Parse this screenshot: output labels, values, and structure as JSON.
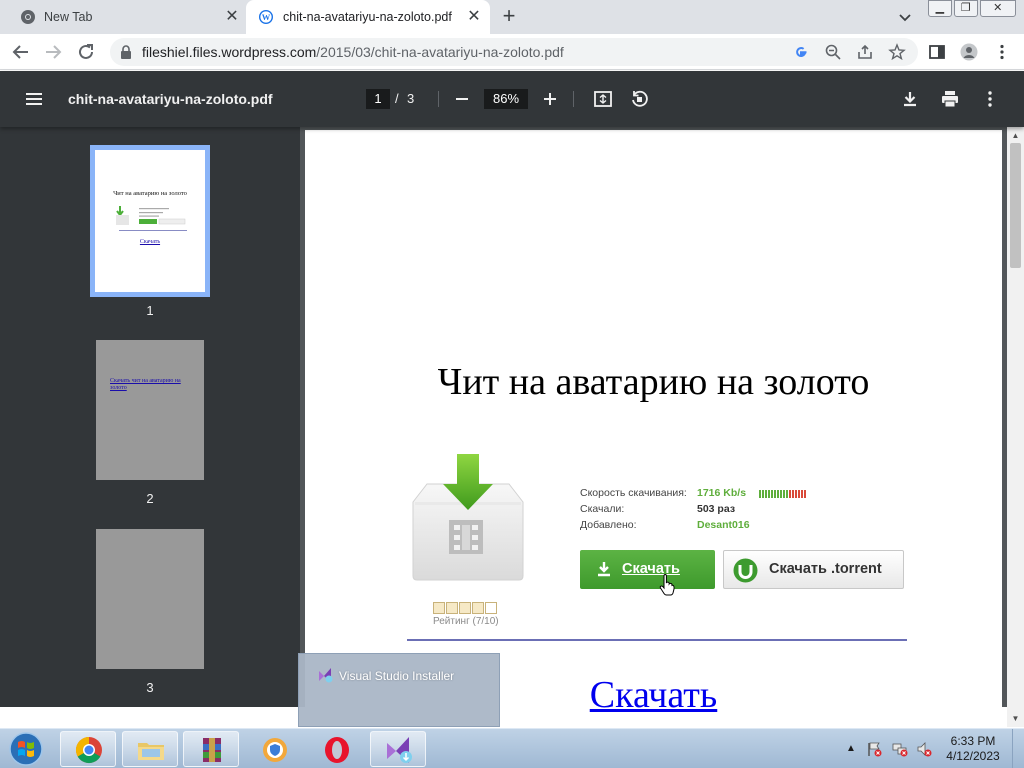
{
  "browser": {
    "tabs": [
      {
        "title": "New Tab",
        "active": false
      },
      {
        "title": "chit-na-avatariyu-na-zoloto.pdf",
        "active": true
      }
    ],
    "address": {
      "host": "fileshiel.files.wordpress.com",
      "path": "/2015/03/chit-na-avatariyu-na-zoloto.pdf"
    },
    "window_buttons": [
      "minimize",
      "restore",
      "close"
    ]
  },
  "pdf_viewer": {
    "filename": "chit-na-avatariyu-na-zoloto.pdf",
    "current_page": "1",
    "page_separator": "/",
    "total_pages": "3",
    "zoom": "86%",
    "thumbnails": [
      {
        "number": "1",
        "title": "Чит на аватарию на золото",
        "link": "Скачать",
        "selected": true
      },
      {
        "number": "2",
        "link": "Скачать чит на аватарию на золото",
        "selected": false
      },
      {
        "number": "3",
        "selected": false
      }
    ]
  },
  "document": {
    "title": "Чит на аватарию на золото",
    "rating_label": "Рейтинг (7/10)",
    "rating_value": 7,
    "rating_max": 10,
    "info": [
      {
        "label": "Скорость скачивания:",
        "value": "1716 Kb/s",
        "color": "#5fae3c"
      },
      {
        "label": "Скачали:",
        "value": "503 раз",
        "color": "#333333"
      },
      {
        "label": "Добавлено:",
        "value": "Desant016",
        "color": "#5fae3c"
      }
    ],
    "download_button": "Скачать",
    "torrent_button": "Скачать .torrent",
    "link": "Скачать"
  },
  "taskbar": {
    "preview_label": "Visual Studio Installer",
    "time": "6:33 PM",
    "date": "4/12/2023",
    "apps": [
      "chrome",
      "file-explorer",
      "winrar",
      "security-app",
      "opera",
      "visual-studio-installer"
    ]
  },
  "colors": {
    "pdf_toolbar": "#323639",
    "viewer_bg": "#525659",
    "accent_green": "#4caf39",
    "thumb_selected": "#8ab4f8"
  }
}
